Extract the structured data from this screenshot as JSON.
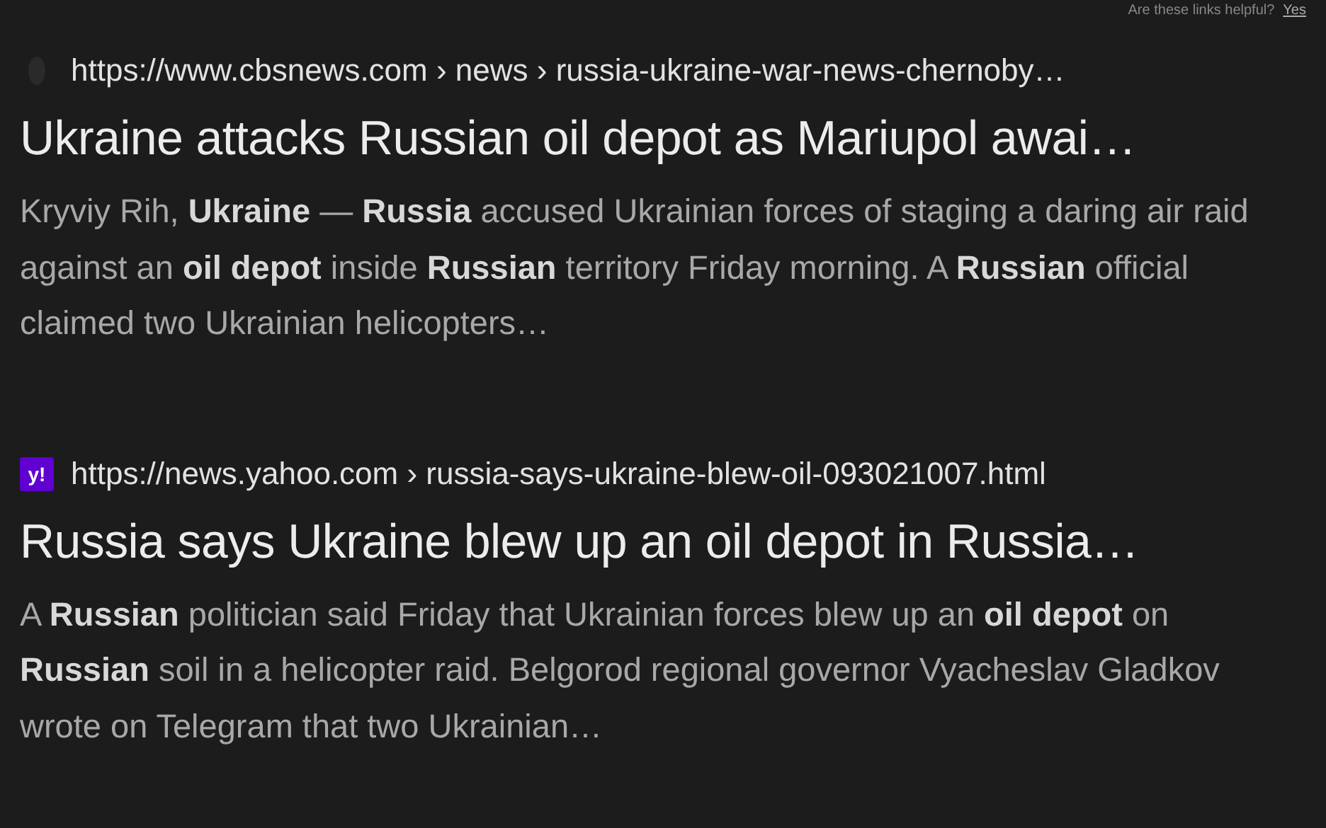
{
  "feedback": {
    "question": "Are these links helpful?",
    "answer": "Yes"
  },
  "results": [
    {
      "kind": "cbs",
      "url": "https://www.cbsnews.com › news › russia-ukraine-war-news-chernoby…",
      "title": "Ukraine attacks Russian oil depot as Mariupol awai…",
      "snippet": "Kryviy Rih, **Ukraine** — **Russia** accused Ukrainian forces of staging a daring air raid against an **oil depot** inside **Russian** territory Friday morning. A **Russian** official claimed two Ukrainian helicopters…"
    },
    {
      "kind": "yahoo",
      "favicon_text": "y!",
      "url": "https://news.yahoo.com › russia-says-ukraine-blew-oil-093021007.html",
      "title": "Russia says Ukraine blew up an oil depot in Russia…",
      "snippet": "A **Russian** politician said Friday that Ukrainian forces blew up an **oil depot** on **Russian** soil in a helicopter raid. Belgorod regional governor Vyacheslav Gladkov wrote on Telegram that two Ukrainian…"
    }
  ]
}
